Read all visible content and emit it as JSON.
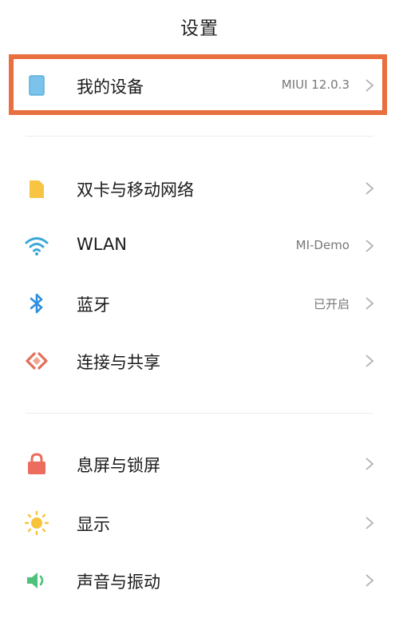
{
  "header": {
    "title": "设置"
  },
  "colors": {
    "highlight_border": "#e86f3f",
    "device_icon": "#7cc3ec",
    "sim_icon": "#f7c543",
    "wifi_icon": "#3aa8d8",
    "bluetooth_icon": "#2f8fe0",
    "share_icon": "#e2705a",
    "lock_icon": "#ec6d5e",
    "display_icon": "#f8c33a",
    "sound_icon": "#4cc27b"
  },
  "section1": {
    "my_device": {
      "icon": "device-icon",
      "label": "我的设备",
      "value": "MIUI 12.0.3"
    }
  },
  "section2": {
    "items": [
      {
        "icon": "sim-card-icon",
        "label": "双卡与移动网络",
        "value": ""
      },
      {
        "icon": "wifi-icon",
        "label": "WLAN",
        "value": "MI-Demo"
      },
      {
        "icon": "bluetooth-icon",
        "label": "蓝牙",
        "value": "已开启"
      },
      {
        "icon": "connection-share-icon",
        "label": "连接与共享",
        "value": ""
      }
    ]
  },
  "section3": {
    "items": [
      {
        "icon": "lock-icon",
        "label": "息屏与锁屏",
        "value": ""
      },
      {
        "icon": "sun-icon",
        "label": "显示",
        "value": ""
      },
      {
        "icon": "speaker-icon",
        "label": "声音与振动",
        "value": ""
      }
    ]
  }
}
